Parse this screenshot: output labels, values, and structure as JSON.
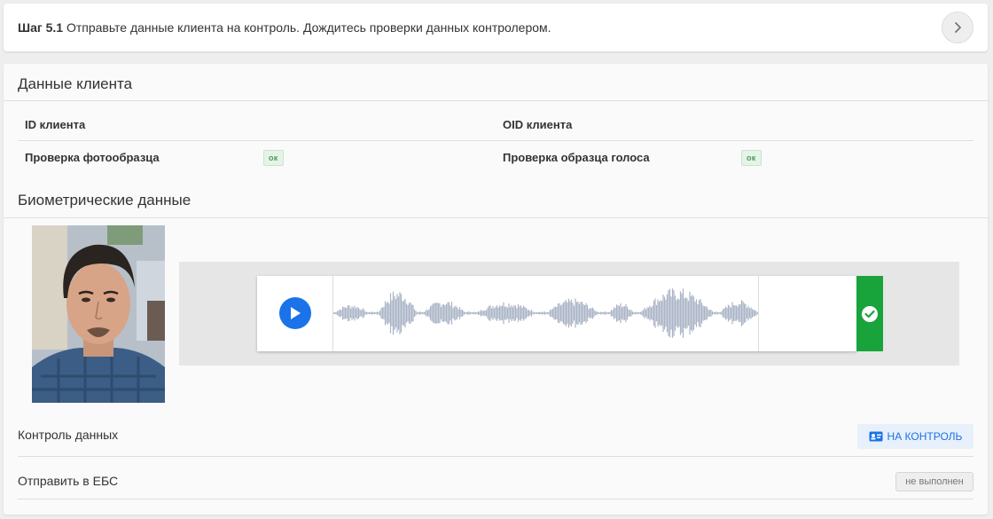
{
  "step": {
    "number": "Шаг 5.1",
    "text": "Отправьте данные клиента на контроль. Дождитесь проверки данных контролером.",
    "next_icon": "chevron-right-icon"
  },
  "client_data": {
    "title": "Данные клиента",
    "id_label": "ID клиента",
    "oid_label": "OID клиента",
    "photo_check_label": "Проверка фотообразца",
    "photo_check_status": "ок",
    "voice_check_label": "Проверка образца голоса",
    "voice_check_status": "ок"
  },
  "biometrics": {
    "title": "Биометрические данные",
    "play_icon": "play-icon",
    "check_icon": "check-circle-icon",
    "status_color": "#18a33b"
  },
  "control": {
    "label": "Контроль данных",
    "button_label": "НА КОНТРОЛЬ",
    "button_icon": "id-card-icon"
  },
  "ebs": {
    "label": "Отправить в ЕБС",
    "status": "не выполнен"
  },
  "colors": {
    "accent": "#1a73e8",
    "success": "#18a33b",
    "waveform": "#a9b4c6"
  }
}
